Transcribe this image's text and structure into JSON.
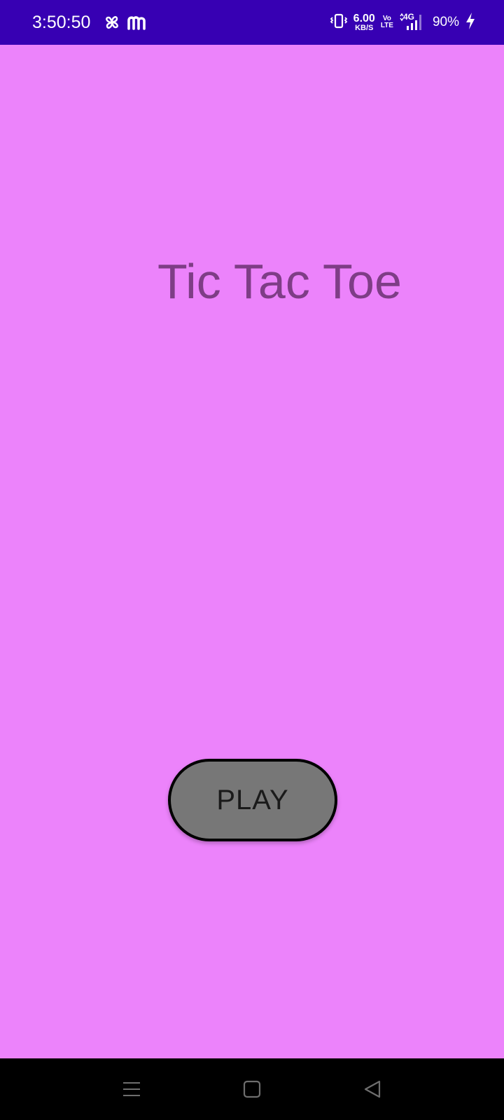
{
  "status_bar": {
    "time": "3:50:50",
    "left_icons": [
      "pinwheel-icon",
      "m-app-icon"
    ],
    "net_speed_value": "6.00",
    "net_speed_unit": "KB/S",
    "volte_top": "Vo",
    "volte_bottom": "LTE",
    "network": "4G",
    "battery": "90%",
    "right_icons": [
      "vibrate-icon",
      "signal-icon",
      "charging-icon"
    ],
    "background": "#3700B3"
  },
  "main": {
    "title": "Tic Tac Toe",
    "play_label": "PLAY",
    "background": "#EC83FB",
    "title_color": "#7E3D86",
    "button_color": "#777777"
  },
  "nav_bar": {
    "buttons": [
      "menu-icon",
      "home-icon",
      "back-icon"
    ]
  }
}
